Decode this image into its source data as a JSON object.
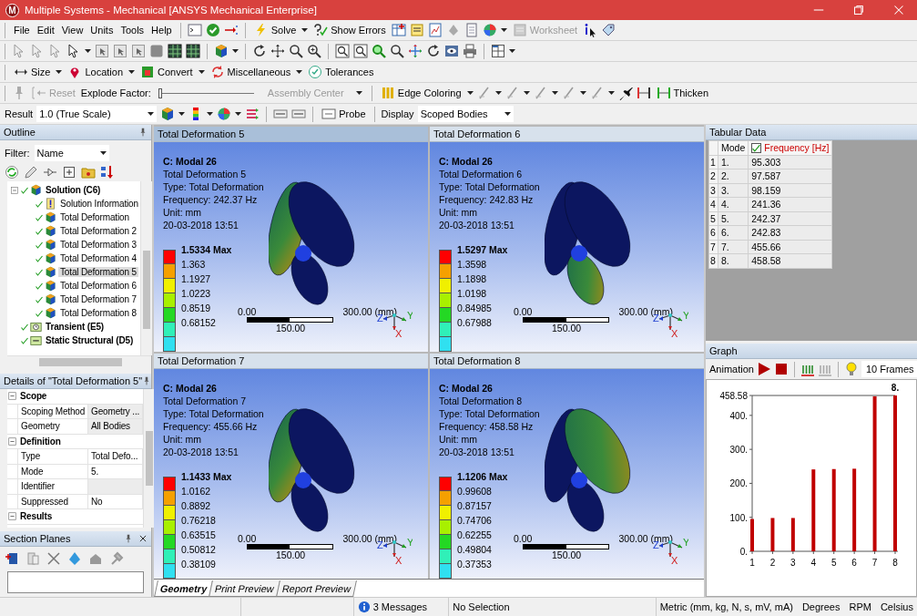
{
  "title_bar": {
    "logo": "M",
    "title": "Multiple Systems - Mechanical [ANSYS Mechanical Enterprise]"
  },
  "menu": [
    "File",
    "Edit",
    "View",
    "Units",
    "Tools",
    "Help"
  ],
  "toolbars": {
    "standard": {
      "solve": "Solve",
      "show_errors": "Show Errors",
      "worksheet": {
        "label": "Worksheet",
        "disabled": true
      }
    },
    "context": [
      {
        "label": "Size",
        "dropdown": true
      },
      {
        "label": "Location",
        "dropdown": true
      },
      {
        "label": "Convert",
        "dropdown": true
      },
      {
        "label": "Miscellaneous",
        "dropdown": true
      },
      {
        "label": "Tolerances",
        "dropdown": false
      }
    ],
    "explode": {
      "reset": {
        "label": "Reset",
        "disabled": true
      },
      "factor_label": "Explode Factor:",
      "factor": {
        "level": 0
      },
      "center": {
        "value": "Assembly Center",
        "disabled": true
      },
      "edge_coloring": "Edge Coloring",
      "thicken": "Thicken"
    },
    "result": {
      "label": "Result",
      "scale": "1.0 (True Scale)",
      "probe": "Probe",
      "display_label": "Display",
      "display": "Scoped Bodies"
    }
  },
  "outline": {
    "title": "Outline",
    "filter_label": "Filter:",
    "filter": "Name",
    "tree": [
      {
        "label": "Solution (C6)",
        "kind": "solution",
        "selected": false,
        "children": [
          {
            "label": "Solution Information",
            "kind": "info",
            "selected": false
          },
          {
            "label": "Total Deformation",
            "kind": "result",
            "selected": false
          },
          {
            "label": "Total Deformation 2",
            "kind": "result",
            "selected": false
          },
          {
            "label": "Total Deformation 3",
            "kind": "result",
            "selected": false
          },
          {
            "label": "Total Deformation 4",
            "kind": "result",
            "selected": false
          },
          {
            "label": "Total Deformation 5",
            "kind": "result",
            "selected": true
          },
          {
            "label": "Total Deformation 6",
            "kind": "result",
            "selected": false
          },
          {
            "label": "Total Deformation 7",
            "kind": "result",
            "selected": false
          },
          {
            "label": "Total Deformation 8",
            "kind": "result",
            "selected": false
          }
        ]
      },
      {
        "label": "Transient (E5)",
        "kind": "transient",
        "selected": false
      },
      {
        "label": "Static Structural (D5)",
        "kind": "static",
        "selected": false
      }
    ]
  },
  "details": {
    "title": "Details of \"Total Deformation 5\"",
    "rows": [
      {
        "kind": "group",
        "label": "Scope",
        "expanded": true
      },
      {
        "kind": "prop",
        "label": "Scoping Method",
        "value": "Geometry ...",
        "editable": false
      },
      {
        "kind": "prop",
        "label": "Geometry",
        "value": "All Bodies",
        "editable": false
      },
      {
        "kind": "group",
        "label": "Definition",
        "expanded": true
      },
      {
        "kind": "prop",
        "label": "Type",
        "value": "Total Defo...",
        "editable": true
      },
      {
        "kind": "prop",
        "label": "Mode",
        "value": "5.",
        "editable": true
      },
      {
        "kind": "prop",
        "label": "Identifier",
        "editable": false
      },
      {
        "kind": "prop",
        "label": "Suppressed",
        "value": "No",
        "editable": true
      },
      {
        "kind": "group",
        "label": "Results",
        "expanded": true
      }
    ]
  },
  "section_planes": {
    "title": "Section Planes"
  },
  "viewports": [
    {
      "title": "Total Deformation 5",
      "selected": true,
      "model": "C: Modal 26",
      "lines": [
        "Total Deformation 5",
        "Type: Total Deformation",
        "Frequency: 242.37 Hz",
        "Unit: mm",
        "20-03-2018 13:51"
      ],
      "legend_max": "1.5334 Max",
      "legend": [
        "1.363",
        "1.1927",
        "1.0223",
        "0.8519",
        "0.68152"
      ],
      "scale": {
        "start": "0.00",
        "end": "300.00 (mm)",
        "mid": "150.00"
      },
      "triad": [
        "Z",
        "Y",
        "X"
      ],
      "blades": [
        {
          "deformed": true
        },
        {
          "deformed": false
        },
        {
          "deformed": false
        }
      ]
    },
    {
      "title": "Total Deformation 6",
      "selected": false,
      "model": "C: Modal 26",
      "lines": [
        "Total Deformation 6",
        "Type: Total Deformation",
        "Frequency: 242.83 Hz",
        "Unit: mm",
        "20-03-2018 13:51"
      ],
      "legend_max": "1.5297 Max",
      "legend": [
        "1.3598",
        "1.1898",
        "1.0198",
        "0.84985",
        "0.67988"
      ],
      "scale": {
        "start": "0.00",
        "end": "300.00 (mm)",
        "mid": "150.00"
      },
      "triad": [
        "Z",
        "Y",
        "X"
      ],
      "blades": [
        {
          "deformed": false
        },
        {
          "deformed": false
        },
        {
          "deformed": true
        }
      ]
    },
    {
      "title": "Total Deformation 7",
      "selected": false,
      "model": "C: Modal 26",
      "lines": [
        "Total Deformation 7",
        "Type: Total Deformation",
        "Frequency: 455.66 Hz",
        "Unit: mm",
        "20-03-2018 13:51"
      ],
      "legend_max": "1.1433 Max",
      "legend": [
        "1.0162",
        "0.8892",
        "0.76218",
        "0.63515",
        "0.50812",
        "0.38109"
      ],
      "scale": {
        "start": "0.00",
        "end": "300.00 (mm)",
        "mid": "150.00"
      },
      "triad": [
        "Z",
        "Y",
        "X"
      ],
      "blades": [
        {
          "deformed": true
        },
        {
          "deformed": false
        },
        {
          "deformed": false
        }
      ]
    },
    {
      "title": "Total Deformation 8",
      "selected": false,
      "model": "C: Modal 26",
      "lines": [
        "Total Deformation 8",
        "Type: Total Deformation",
        "Frequency: 458.58 Hz",
        "Unit: mm",
        "20-03-2018 13:51"
      ],
      "legend_max": "1.1206 Max",
      "legend": [
        "0.99608",
        "0.87157",
        "0.74706",
        "0.62255",
        "0.49804",
        "0.37353"
      ],
      "scale": {
        "start": "0.00",
        "end": "300.00 (mm)",
        "mid": "150.00"
      },
      "triad": [
        "Z",
        "Y",
        "X"
      ],
      "blades": [
        {
          "deformed": false
        },
        {
          "deformed": true
        },
        {
          "deformed": false
        }
      ]
    }
  ],
  "view_tabs": [
    {
      "label": "Geometry",
      "selected": true
    },
    {
      "label": "Print Preview",
      "selected": false
    },
    {
      "label": "Report Preview",
      "selected": false
    }
  ],
  "tabular": {
    "title": "Tabular Data",
    "columns": [
      {
        "label": "Mode"
      },
      {
        "label": "Frequency [Hz]",
        "checked": true
      }
    ],
    "rows": [
      {
        "index": "1",
        "mode": "1.",
        "frequency": "95.303"
      },
      {
        "index": "2",
        "mode": "2.",
        "frequency": "97.587"
      },
      {
        "index": "3",
        "mode": "3.",
        "frequency": "98.159"
      },
      {
        "index": "4",
        "mode": "4.",
        "frequency": "241.36"
      },
      {
        "index": "5",
        "mode": "5.",
        "frequency": "242.37"
      },
      {
        "index": "6",
        "mode": "6.",
        "frequency": "242.83"
      },
      {
        "index": "7",
        "mode": "7.",
        "frequency": "455.66"
      },
      {
        "index": "8",
        "mode": "8.",
        "frequency": "458.58"
      }
    ]
  },
  "graph": {
    "title": "Graph",
    "animation_label": "Animation",
    "frames": "10 Frames",
    "chart_data": {
      "type": "bar",
      "categories": [
        "1",
        "2",
        "3",
        "4",
        "5",
        "6",
        "7",
        "8"
      ],
      "series": [
        {
          "color": "#c00000",
          "values": [
            95,
            98,
            98,
            241,
            242,
            243,
            456,
            458.58
          ]
        }
      ],
      "ylim": [
        0,
        458.58
      ],
      "yticks": [
        {
          "value": 0,
          "label": "0."
        },
        {
          "value": 100,
          "label": "100."
        },
        {
          "value": 200,
          "label": "200."
        },
        {
          "value": 300,
          "label": "300."
        },
        {
          "value": 400,
          "label": "400."
        },
        {
          "value": 458.58,
          "label": "458.58"
        }
      ],
      "annotations": [
        {
          "x": "8",
          "y": 458.58,
          "text": "8."
        }
      ]
    }
  },
  "status_bar": {
    "messages": "3 Messages",
    "selection": "No Selection",
    "units": "Metric (mm, kg, N, s, mV, mA)",
    "angle": "Degrees",
    "speed": "RPM",
    "temperature": "Celsius"
  }
}
